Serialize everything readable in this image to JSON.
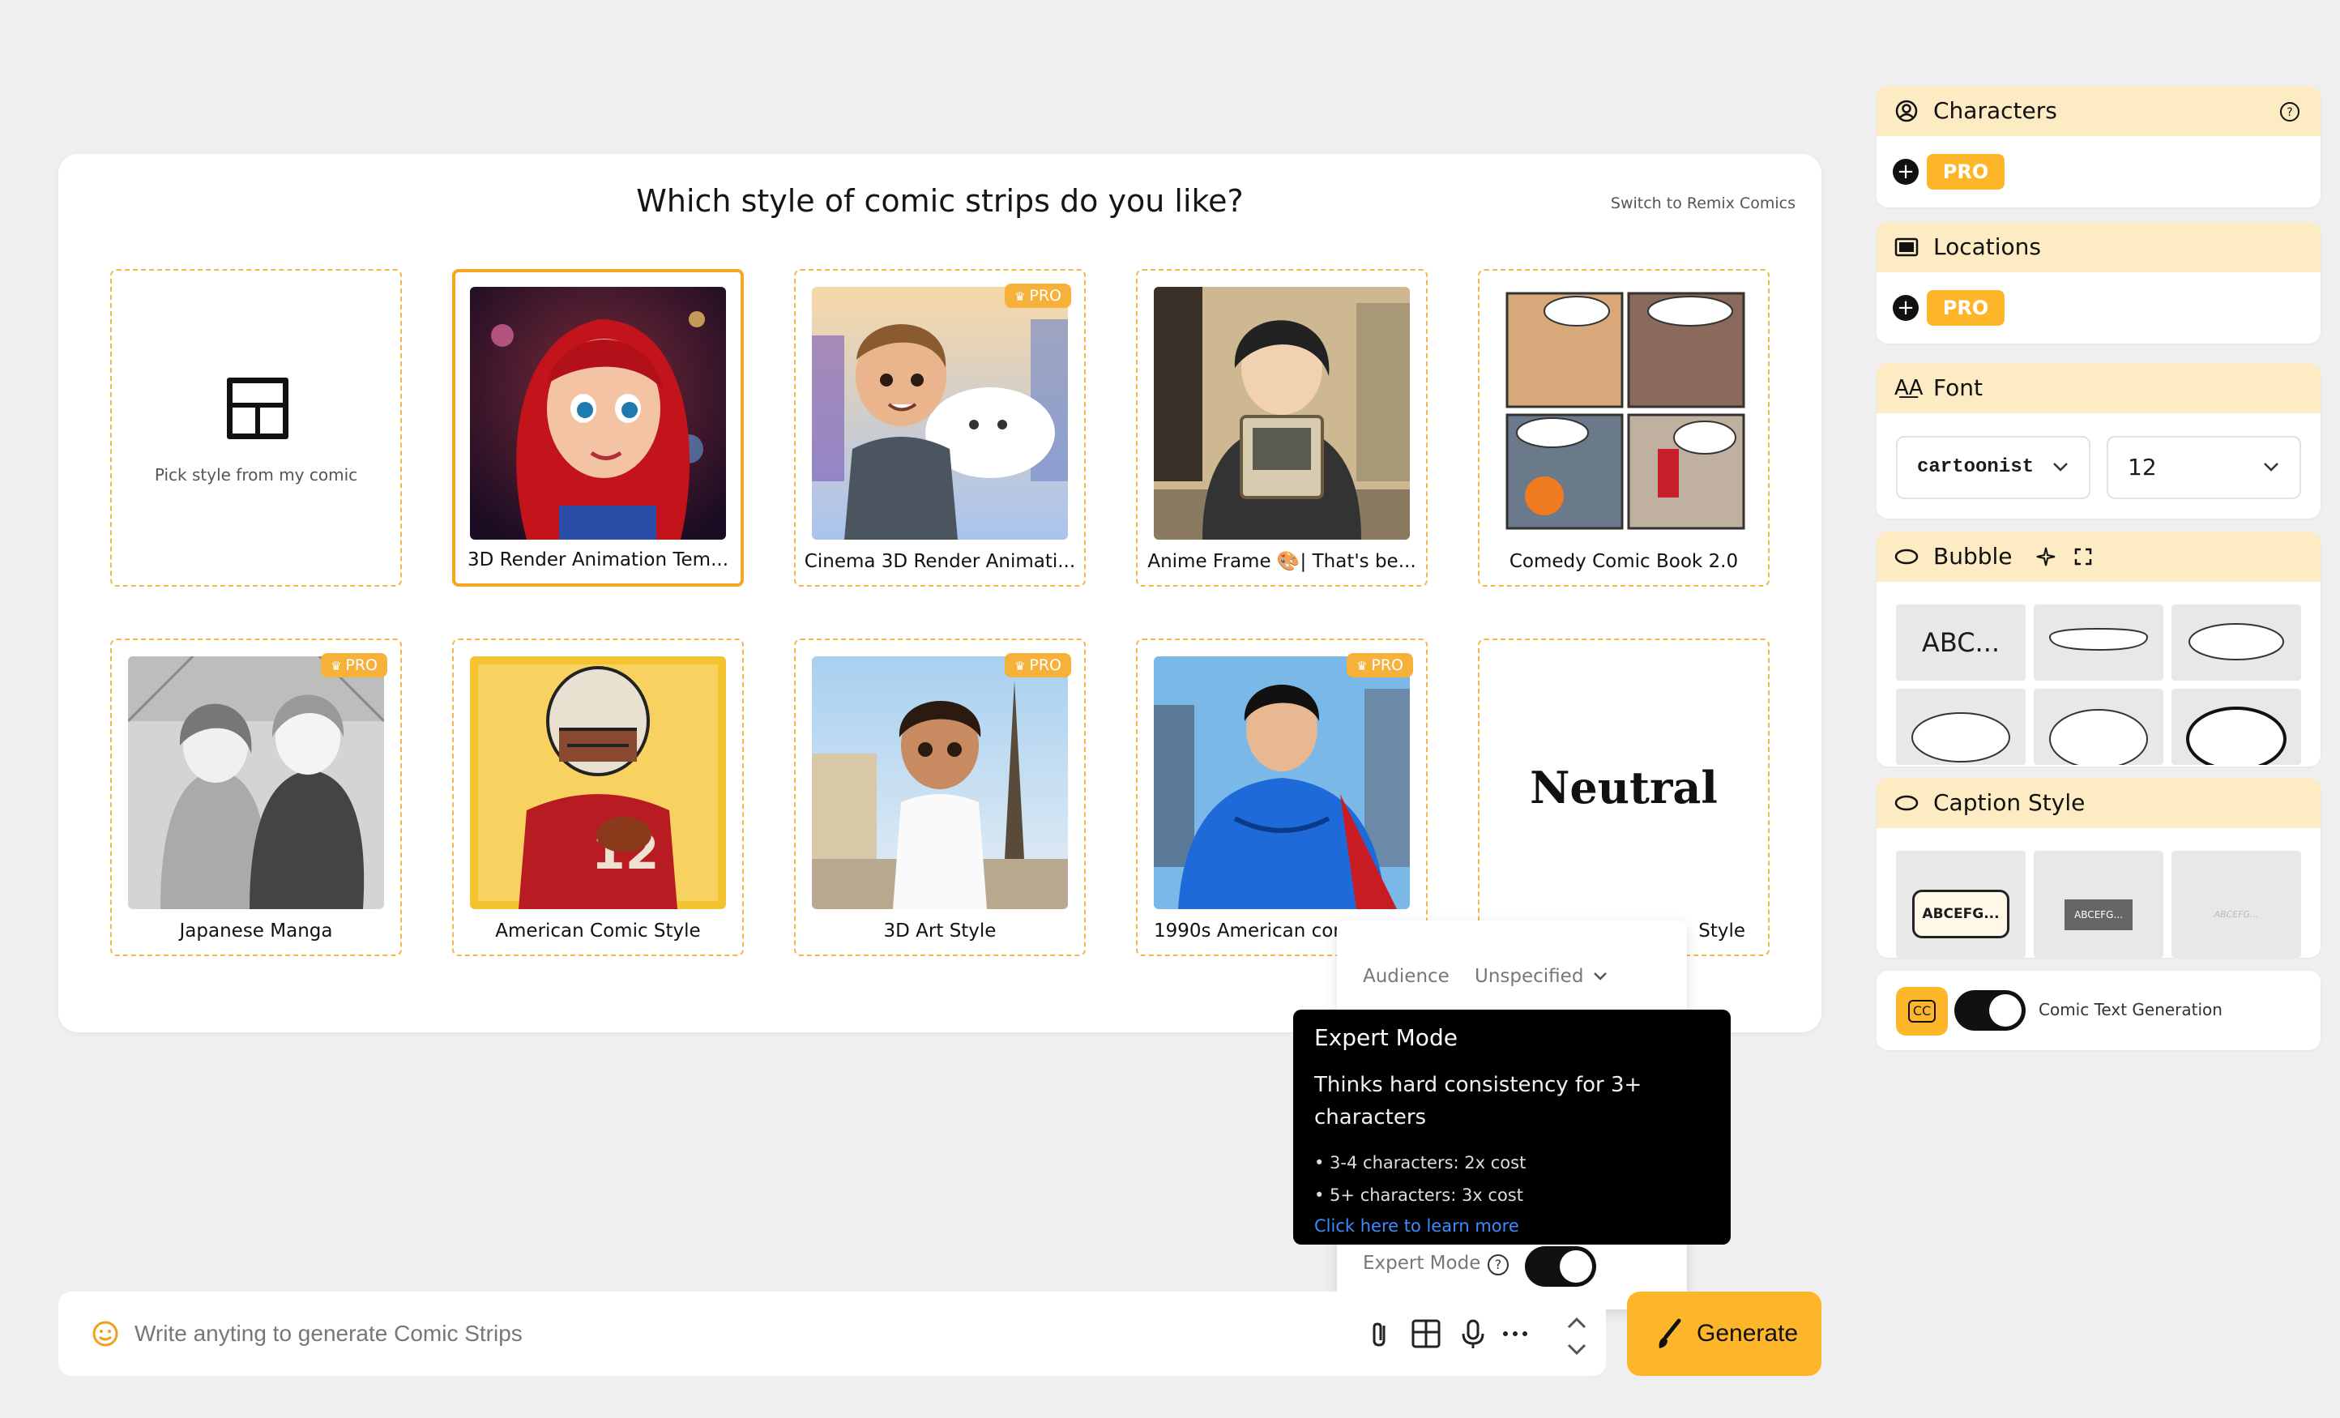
{
  "picker": {
    "title": "Which style of comic strips do you like?",
    "switch_link": "Switch to Remix Comics",
    "pick_from_comic": "Pick style from my comic",
    "styles": [
      {
        "label": "3D Render Animation Tem...",
        "pro": false,
        "selected": true
      },
      {
        "label": "Cinema 3D Render Animati...",
        "pro": true
      },
      {
        "label": "Anime Frame 🎨| That's be...",
        "pro": false
      },
      {
        "label": "Comedy Comic Book 2.0",
        "pro": false
      },
      {
        "label": "Japanese Manga",
        "pro": true
      },
      {
        "label": "American Comic Style",
        "pro": false
      },
      {
        "label": "3D Art Style",
        "pro": true
      },
      {
        "label": "1990s American com",
        "pro": true
      },
      {
        "label": "Style",
        "pro": false
      }
    ],
    "neutral_text": "Neutral",
    "pro_badge": "PRO"
  },
  "audience": {
    "label": "Audience",
    "value": "Unspecified"
  },
  "expert_tooltip": {
    "title": "Expert Mode",
    "desc": "Thinks hard consistency for 3+ characters",
    "bullet1": "• 3-4 characters: 2x cost",
    "bullet2": "• 5+ characters: 3x cost",
    "link": "Click here to learn more"
  },
  "expert_mode": {
    "label": "Expert Mode",
    "enabled": true
  },
  "prompt": {
    "placeholder": "Write anyting to generate Comic Strips"
  },
  "generate_label": "Generate",
  "sidebar": {
    "characters": {
      "title": "Characters",
      "pro": "PRO"
    },
    "locations": {
      "title": "Locations",
      "pro": "PRO"
    },
    "font": {
      "title": "Font",
      "family_value": "cartoonist",
      "size_value": "12"
    },
    "bubble": {
      "title": "Bubble",
      "sample": "ABC..."
    },
    "caption": {
      "title": "Caption Style",
      "sample1": "ABCEFG...",
      "sample2": "ABCEFG...",
      "sample3": "ABCEFG..."
    },
    "comic_text": {
      "label": "Comic Text Generation",
      "icon_text": "CC",
      "enabled": true
    }
  },
  "colors": {
    "accent": "#fdb52a",
    "header_bg": "#fdebc3",
    "tooltip_bg": "#000000",
    "link": "#3b8cff"
  }
}
